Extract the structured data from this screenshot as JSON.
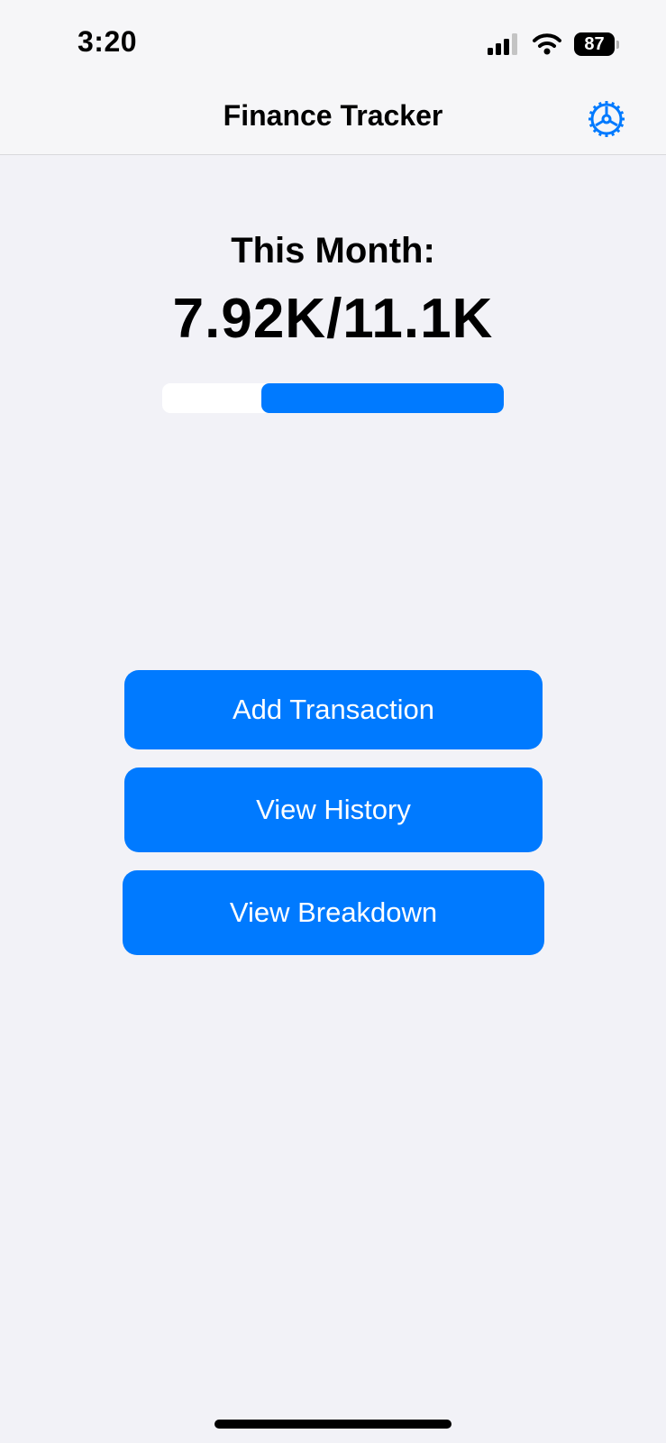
{
  "status_bar": {
    "time": "3:20",
    "signal_icon": "cellular-signal-icon",
    "wifi_icon": "wifi-icon",
    "battery_level": "87"
  },
  "nav": {
    "title": "Finance Tracker",
    "settings_icon": "gear-icon"
  },
  "summary": {
    "label": "This Month:",
    "amount": "7.92K/11.1K",
    "progress_fill_fraction": 0.71
  },
  "actions": {
    "add_transaction": "Add Transaction",
    "view_history": "View History",
    "view_breakdown": "View Breakdown"
  },
  "colors": {
    "accent": "#007aff",
    "background": "#f2f2f7",
    "nav_background": "#f6f6f8",
    "track": "#ffffff"
  }
}
